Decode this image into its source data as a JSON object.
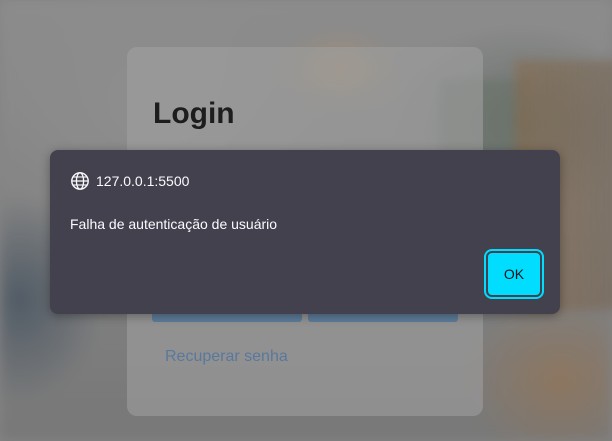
{
  "background": {
    "login_title": "Login",
    "recover_link": "Recuperar senha"
  },
  "dialog": {
    "origin": "127.0.0.1:5500",
    "origin_icon": "globe-icon",
    "message": "Falha de autenticação de usuário",
    "ok_label": "OK"
  },
  "colors": {
    "dialog_bg": "#42414d",
    "ok_button": "#00ddff",
    "link": "#5a7fab"
  }
}
